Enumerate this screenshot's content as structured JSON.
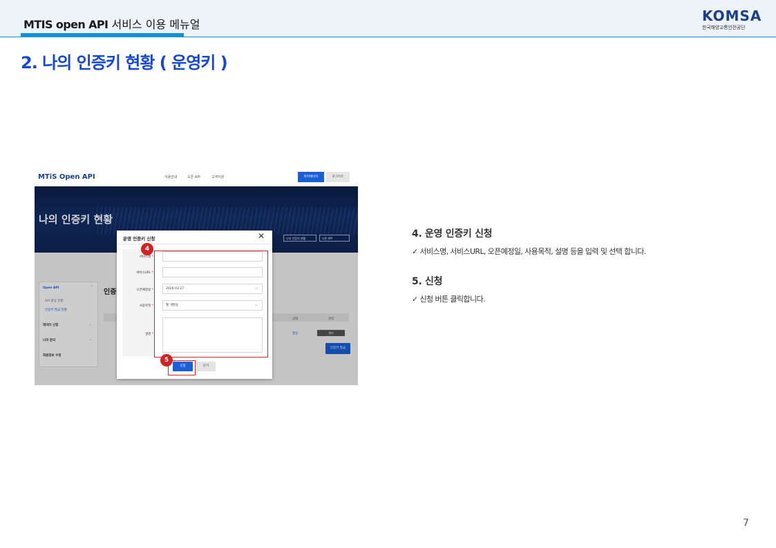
{
  "header": {
    "title_bold": "MTIS open API",
    "title_rest": " 서비스 이용 메뉴얼",
    "logo_text": "KOMSA",
    "logo_sub": "한국해양교통안전공단"
  },
  "section_title": "2. 나의 인증키 현황 ( 운영키 )",
  "screenshot": {
    "nav_logo": "MTiS Open API",
    "nav_menu": [
      "이용안내",
      "오픈 API",
      "고객지원"
    ],
    "nav_mypage": "마이페이지",
    "nav_logout": "로그아웃",
    "hero_title": "나의 인증키 현황",
    "hero_selects": [
      "나의 인증키 현황",
      "오픈 API"
    ],
    "sidebar": {
      "group": "Open API",
      "subitems": [
        "API 활용 현황",
        "인증키 발급 현황"
      ],
      "items": [
        "데이터 신청",
        "나의 문의",
        "회원정보 수정"
      ]
    },
    "content_heading": "인증",
    "table_headers": [
      "상태",
      "관리"
    ],
    "row_status": "정상",
    "row_action": "관리",
    "issue_button": "인증키 발급",
    "modal": {
      "title": "운영 인증키 신청",
      "close": "✕",
      "fields": [
        {
          "label": "서비스명",
          "value": ""
        },
        {
          "label": "서비스URL",
          "value": ""
        },
        {
          "label": "오픈예정일",
          "value": "2026-03-27"
        },
        {
          "label": "사용목적",
          "value": "웹 개발용"
        },
        {
          "label": "설명",
          "value": ""
        }
      ],
      "required_mark": "*",
      "apply_button": "신청",
      "cancel_button": "닫기"
    },
    "badge_4": "4",
    "badge_5": "5"
  },
  "steps": [
    {
      "title": "4.  운영 인증키 신청",
      "desc": "✓ 서비스명, 서비스URL, 오픈예정일, 사용목적, 설명 등을 입력 및 선택 합니다."
    },
    {
      "title": "5.  신청",
      "desc": "✓ 신청 버튼 클릭합니다."
    }
  ],
  "page_number": "7",
  "colors": {
    "accent": "#0a91d8",
    "title_blue": "#1447d6",
    "highlight_red": "#d42121",
    "button_blue": "#1a5fd6"
  }
}
